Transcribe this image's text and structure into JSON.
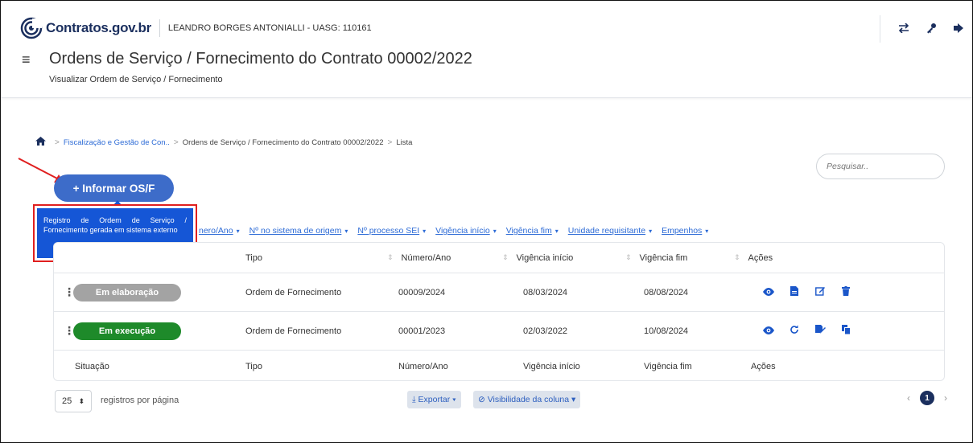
{
  "header": {
    "logo_text": "Contratos.gov.br",
    "user_info": "LEANDRO BORGES ANTONIALLI - UASG: 110161",
    "title": "Ordens de Serviço / Fornecimento do Contrato 00002/2022",
    "subtitle": "Visualizar Ordem de Serviço / Fornecimento",
    "icons": {
      "switch": "⇄",
      "key": "🔑",
      "logout": "⇥"
    }
  },
  "breadcrumb": {
    "item1": "Fiscalização e Gestão de Con..",
    "item2": "Ordens de Serviço / Fornecimento do Contrato 00002/2022",
    "item3": "Lista"
  },
  "search": {
    "placeholder": "Pesquisar.."
  },
  "informar_button": {
    "label": "+ Informar OS/F"
  },
  "tooltip": {
    "text": "Registro de Ordem de Serviço / Fornecimento gerada em sistema externo"
  },
  "filters": [
    "nero/Ano",
    "Nº no sistema de origem",
    "Nº processo SEI",
    "Vigência início",
    "Vigência fim",
    "Unidade requisitante",
    "Empenhos"
  ],
  "table": {
    "headers": {
      "tipo": "Tipo",
      "numero": "Número/Ano",
      "inicio": "Vigência início",
      "fim": "Vigência fim",
      "acoes": "Ações"
    },
    "rows": [
      {
        "situacao": "Em elaboração",
        "situacao_color": "#a3a3a3",
        "tipo": "Ordem de Fornecimento",
        "numero": "00009/2024",
        "inicio": "08/03/2024",
        "fim": "08/08/2024"
      },
      {
        "situacao": "Em execução",
        "situacao_color": "#1e8a2a",
        "tipo": "Ordem de Fornecimento",
        "numero": "00001/2023",
        "inicio": "02/03/2022",
        "fim": "10/08/2024"
      }
    ],
    "footer": {
      "situacao": "Situação",
      "tipo": "Tipo",
      "numero": "Número/Ano",
      "inicio": "Vigência início",
      "fim": "Vigência fim",
      "acoes": "Ações"
    }
  },
  "pagination": {
    "per_page": "25",
    "per_page_label": "registros por página",
    "export_label": "⤓ Exportar ▾",
    "visibility_label": "Visibilidade da coluna ▾",
    "current_page": "1"
  }
}
